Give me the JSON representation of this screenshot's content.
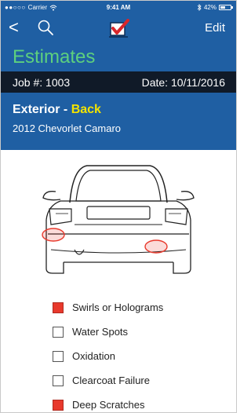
{
  "status_bar": {
    "signal": "●●○○○",
    "carrier": "Carrier",
    "time": "9:41 AM",
    "battery": "42%"
  },
  "nav": {
    "back_icon": "chevron-left-icon",
    "back_glyph": "<",
    "search_icon": "search-icon",
    "logo_icon": "checkmark-logo-icon",
    "edit_label": "Edit"
  },
  "page": {
    "title": "Estimates"
  },
  "job": {
    "number_label": "Job #: 1003",
    "date_label": "Date: 10/11/2016"
  },
  "vehicle": {
    "section": "Exterior - ",
    "side": "Back",
    "name": "2012 Chevorlet Camaro"
  },
  "checklist": {
    "items": [
      {
        "label": "Swirls or Holograms",
        "checked": true
      },
      {
        "label": "Water Spots",
        "checked": false
      },
      {
        "label": "Oxidation",
        "checked": false
      },
      {
        "label": "Clearcoat Failure",
        "checked": false
      },
      {
        "label": "Deep Scratches",
        "checked": true
      }
    ]
  },
  "colors": {
    "header_blue": "#1f5fa3",
    "job_bar": "#101a28",
    "title_green": "#5dd07e",
    "accent_yellow": "#f2e300",
    "checked_red": "#e8392c"
  }
}
